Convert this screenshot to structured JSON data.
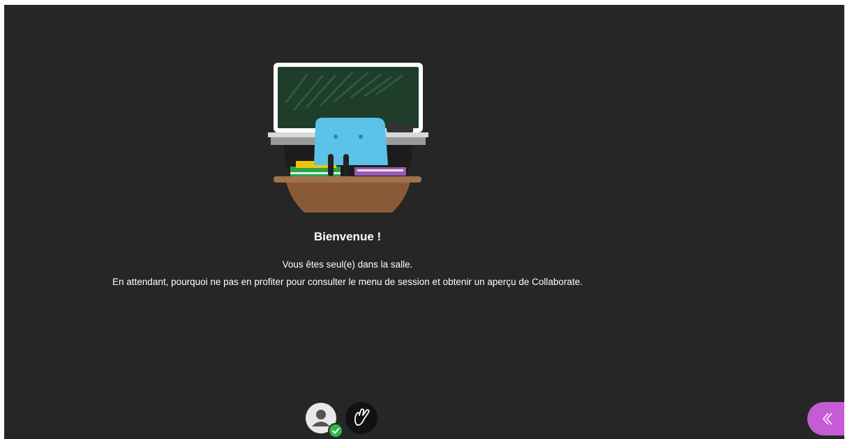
{
  "welcome": {
    "title": "Bienvenue !",
    "line1": "Vous êtes seul(e) dans la salle.",
    "line2": "En attendant, pourquoi ne pas en profiter pour consulter le menu de session et obtenir un aperçu de Collaborate."
  },
  "controls": {
    "avatar_status": "online",
    "avatar_icon": "user-avatar-icon",
    "status_icon": "check-icon",
    "hand_icon": "raise-hand-icon",
    "panel_icon": "double-chevron-left-icon"
  },
  "colors": {
    "background": "#262626",
    "accent_panel": "#c65bd6",
    "status_online": "#2fb54a"
  }
}
